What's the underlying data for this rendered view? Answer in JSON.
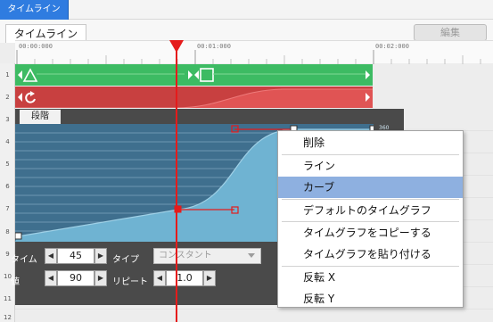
{
  "window_tab": {
    "label": "タイムライン"
  },
  "panel": {
    "title": "タイムライン",
    "edit_button": "編集"
  },
  "ruler": {
    "ticks": [
      "00:00:000",
      "00:01:000",
      "00:02:000"
    ]
  },
  "rows": [
    "1",
    "2",
    "3",
    "4",
    "5",
    "6",
    "7",
    "8",
    "9",
    "10",
    "11",
    "12"
  ],
  "graph": {
    "tab_label": "段階",
    "max_value_label": "360"
  },
  "controls": {
    "time_label": "タイム",
    "time_value": "45",
    "type_label": "タイプ",
    "type_value": "コンスタント",
    "value_label": "値",
    "value_value": "90",
    "repeat_label": "リピート",
    "repeat_value": "1.0"
  },
  "context_menu": {
    "items": [
      {
        "label": "削除"
      },
      {
        "label": "ライン"
      },
      {
        "label": "カーブ",
        "highlighted": true
      },
      {
        "label": "デフォルトのタイムグラフ"
      },
      {
        "label": "タイムグラフをコピーする"
      },
      {
        "label": "タイムグラフを貼り付ける"
      },
      {
        "label": "反転 X"
      },
      {
        "label": "反転 Y"
      }
    ]
  },
  "colors": {
    "accent": "#2f7ce0",
    "track_green": "#3dbb63",
    "track_red": "#c84040",
    "graph_fill": "#6fb3d2",
    "graph_bg": "#3f6f8e",
    "playhead": "#e51b1b",
    "menu_highlight": "#8eb0e0"
  }
}
